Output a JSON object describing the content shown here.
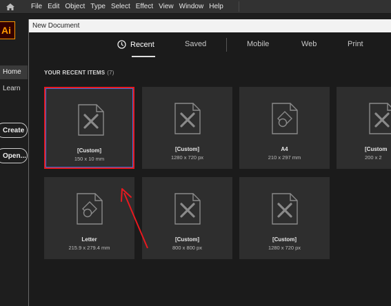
{
  "menubar": {
    "home_icon": "home-icon",
    "items": [
      "File",
      "Edit",
      "Object",
      "Type",
      "Select",
      "Effect",
      "View",
      "Window",
      "Help"
    ]
  },
  "app": {
    "logo_text": "Ai",
    "nav": {
      "home": "Home",
      "learn": "Learn"
    },
    "create_button": "Create",
    "open_button": "Open..."
  },
  "dialog": {
    "title": "New Document",
    "tabs": {
      "recent": "Recent",
      "saved": "Saved",
      "mobile": "Mobile",
      "web": "Web",
      "print": "Print"
    },
    "recent_heading": "YOUR RECENT ITEMS",
    "recent_count": "(7)",
    "items": [
      {
        "name": "[Custom]",
        "size": "150 x 10 mm",
        "icon": "custom-doc-icon"
      },
      {
        "name": "[Custom]",
        "size": "1280 x 720 px",
        "icon": "custom-doc-icon"
      },
      {
        "name": "A4",
        "size": "210 x 297 mm",
        "icon": "print-doc-icon"
      },
      {
        "name": "[Custom",
        "size": "200 x 2",
        "icon": "custom-doc-icon"
      },
      {
        "name": "Letter",
        "size": "215.9 x 279.4 mm",
        "icon": "print-doc-icon"
      },
      {
        "name": "[Custom]",
        "size": "800 x 800 px",
        "icon": "custom-doc-icon"
      },
      {
        "name": "[Custom]",
        "size": "1280 x 720 px",
        "icon": "custom-doc-icon"
      }
    ]
  },
  "annotation": {
    "highlight_color": "#e8191f",
    "arrow_color": "#e8191f"
  }
}
